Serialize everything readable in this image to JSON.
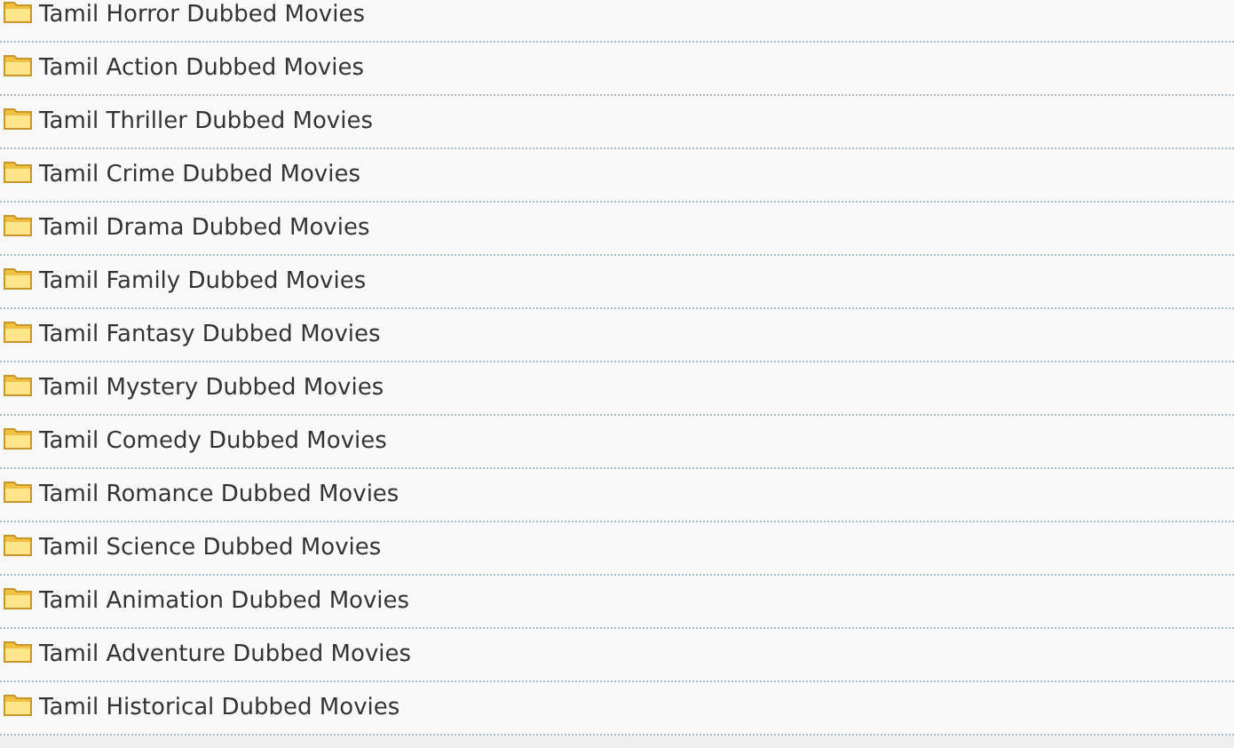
{
  "categories": [
    {
      "label": "Tamil Horror Dubbed Movies"
    },
    {
      "label": "Tamil Action Dubbed Movies"
    },
    {
      "label": "Tamil Thriller Dubbed Movies"
    },
    {
      "label": "Tamil Crime Dubbed Movies"
    },
    {
      "label": "Tamil Drama Dubbed Movies"
    },
    {
      "label": "Tamil Family Dubbed Movies"
    },
    {
      "label": "Tamil Fantasy Dubbed Movies"
    },
    {
      "label": "Tamil Mystery Dubbed Movies"
    },
    {
      "label": "Tamil Comedy Dubbed Movies"
    },
    {
      "label": "Tamil Romance Dubbed Movies"
    },
    {
      "label": "Tamil Science Dubbed Movies"
    },
    {
      "label": "Tamil Animation Dubbed Movies"
    },
    {
      "label": "Tamil Adventure Dubbed Movies"
    },
    {
      "label": "Tamil Historical Dubbed Movies"
    }
  ]
}
